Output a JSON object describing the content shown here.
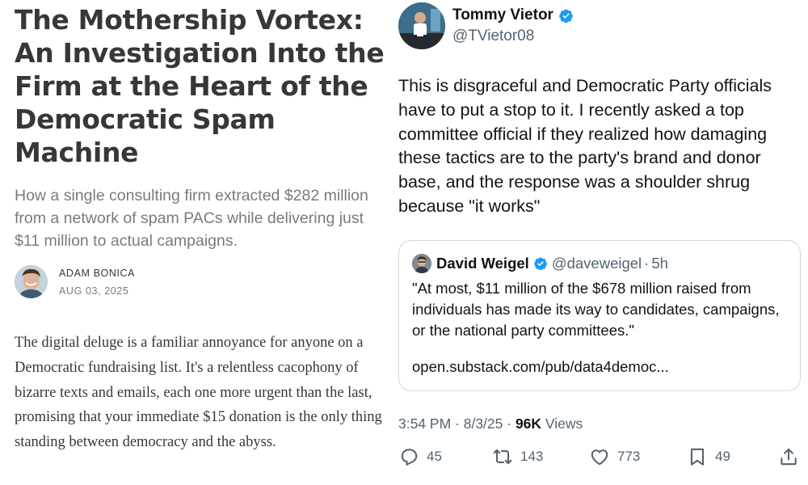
{
  "article": {
    "title": "The Mothership Vortex: An Investigation Into the Firm at the Heart of the Democratic Spam Machine",
    "subtitle": "How a single consulting firm extracted $282 million from a network of spam PACs while delivering just $11 million to actual campaigns.",
    "author": "ADAM BONICA",
    "date": "AUG 03, 2025",
    "body": "The digital deluge is a familiar annoyance for anyone on a Democratic fundraising list. It's a relentless cacophony of bizarre texts and emails, each one more urgent than the last, promising that your immediate $15 donation is the only thing standing between democracy and the abyss."
  },
  "tweet": {
    "name": "Tommy Vietor",
    "handle": "@TVietor08",
    "text": "This is disgraceful and Democratic Party officials have to put a stop to it. I recently asked a top committee official if they realized how damaging these tactics are to the party's brand and donor base, and the response was a shoulder shrug because \"it works\"",
    "quote": {
      "name": "David Weigel",
      "handle": "@daveweigel",
      "separator": "·",
      "time": "5h",
      "text": "\"At most, $11 million of the $678 million raised from individuals has made its way to candidates, campaigns, or the national party committees.\"",
      "link": "open.substack.com/pub/data4democ..."
    },
    "timestamp": "3:54 PM · 8/3/25 · ",
    "views_count": "96K",
    "views_label": " Views",
    "stats": {
      "replies": "45",
      "retweets": "143",
      "likes": "773",
      "bookmarks": "49"
    }
  },
  "colors": {
    "verified_blue": "#1d9bf0",
    "secondary_text": "#536471",
    "substack_title": "#363737"
  },
  "icons": {
    "reply": "reply-icon",
    "retweet": "retweet-icon",
    "like": "heart-icon",
    "bookmark": "bookmark-icon",
    "share": "share-icon",
    "verified": "verified-badge-icon"
  }
}
